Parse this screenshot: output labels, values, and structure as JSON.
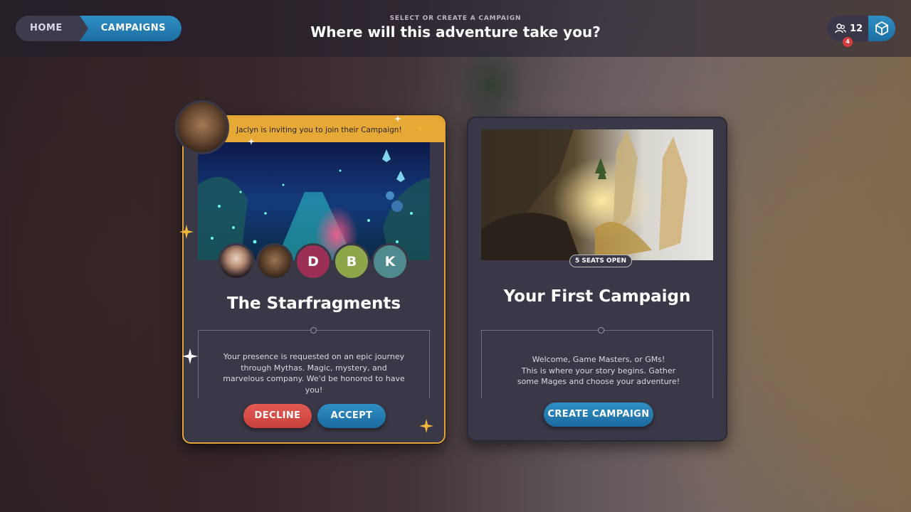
{
  "nav": {
    "home": "HOME",
    "campaigns": "CAMPAIGNS"
  },
  "header": {
    "subtitle": "SELECT OR CREATE A CAMPAIGN",
    "title": "Where will this adventure take you?"
  },
  "friends": {
    "count": "12",
    "notifications": "4"
  },
  "invite_card": {
    "banner": "Jaclyn is inviting you to join their Campaign!",
    "title": "The Starfragments",
    "members": [
      "D",
      "B",
      "K"
    ],
    "description": "Your presence is requested on an epic journey through Mythas. Magic, mystery, and marvelous company. We'd be honored to have you!",
    "decline_label": "DECLINE",
    "accept_label": "ACCEPT"
  },
  "create_card": {
    "seats": "5 SEATS OPEN",
    "title": "Your First Campaign",
    "description_lines": [
      "Welcome, Game Masters, or GMs!",
      "This is where your story begins. Gather",
      "some Mages and choose your adventure!"
    ],
    "create_label": "CREATE CAMPAIGN"
  },
  "colors": {
    "accent_blue": "#2f8fc4",
    "invite_gold": "#e7a935",
    "decline_red": "#d24b45",
    "card_bg": "#3a3746"
  }
}
